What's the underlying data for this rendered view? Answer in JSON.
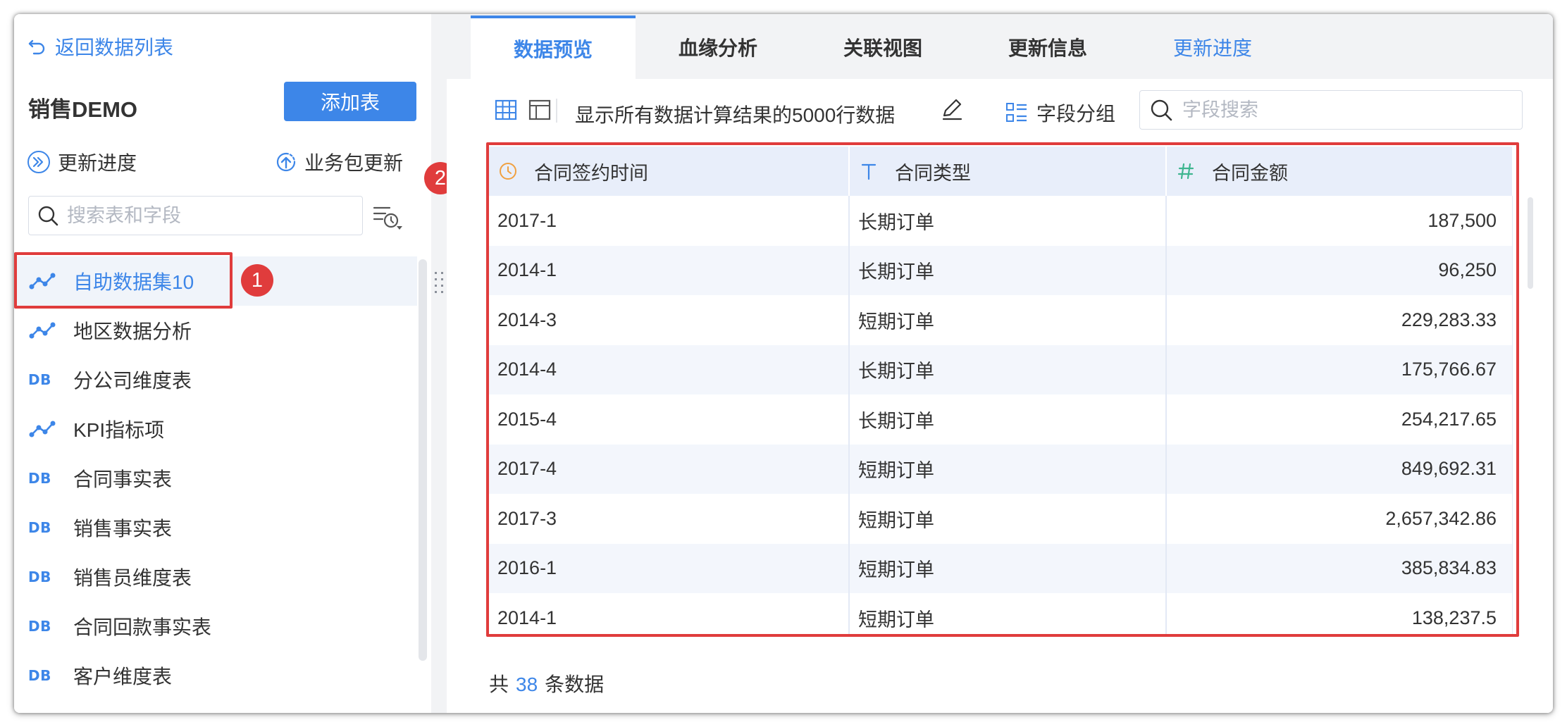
{
  "sidebar": {
    "back_label": "返回数据列表",
    "package_title": "销售DEMO",
    "add_table_label": "添加表",
    "update_progress_label": "更新进度",
    "package_update_label": "业务包更新",
    "search_placeholder": "搜索表和字段",
    "items": [
      {
        "label": "自助数据集10",
        "icon": "self-service-dataset-icon",
        "active": true
      },
      {
        "label": "地区数据分析",
        "icon": "self-service-dataset-icon"
      },
      {
        "label": "分公司维度表",
        "icon": "db-table-icon"
      },
      {
        "label": "KPI指标项",
        "icon": "self-service-dataset-icon"
      },
      {
        "label": "合同事实表",
        "icon": "db-table-icon"
      },
      {
        "label": "销售事实表",
        "icon": "db-table-icon"
      },
      {
        "label": "销售员维度表",
        "icon": "db-table-icon"
      },
      {
        "label": "合同回款事实表",
        "icon": "db-table-icon"
      },
      {
        "label": "客户维度表",
        "icon": "db-table-icon"
      }
    ],
    "db_icon_text": "DB"
  },
  "annotations": {
    "one": "1",
    "two": "2"
  },
  "tabs": [
    "数据预览",
    "血缘分析",
    "关联视图",
    "更新信息",
    "更新进度"
  ],
  "toolbar": {
    "info_text": "显示所有数据计算结果的5000行数据",
    "group_label": "字段分组",
    "field_search_placeholder": "字段搜索"
  },
  "table": {
    "columns": [
      {
        "label": "合同签约时间",
        "type": "date",
        "icon": "clock-icon"
      },
      {
        "label": "合同类型",
        "type": "text",
        "icon": "text-type-icon"
      },
      {
        "label": "合同金额",
        "type": "number",
        "icon": "hash-icon"
      }
    ],
    "rows": [
      [
        "2017-1",
        "长期订单",
        "187,500"
      ],
      [
        "2014-1",
        "长期订单",
        "96,250"
      ],
      [
        "2014-3",
        "短期订单",
        "229,283.33"
      ],
      [
        "2014-4",
        "长期订单",
        "175,766.67"
      ],
      [
        "2015-4",
        "长期订单",
        "254,217.65"
      ],
      [
        "2017-4",
        "短期订单",
        "849,692.31"
      ],
      [
        "2017-3",
        "短期订单",
        "2,657,342.86"
      ],
      [
        "2016-1",
        "短期订单",
        "385,834.83"
      ],
      [
        "2014-1",
        "短期订单",
        "138,237.5"
      ]
    ]
  },
  "footer": {
    "prefix": "共",
    "count": "38",
    "suffix": "条数据"
  },
  "colors": {
    "accent": "#3d86e8",
    "annotation": "#e03c3c",
    "header_bg": "#e8eefa",
    "date_icon": "#f0a040",
    "number_icon": "#3db58f"
  }
}
